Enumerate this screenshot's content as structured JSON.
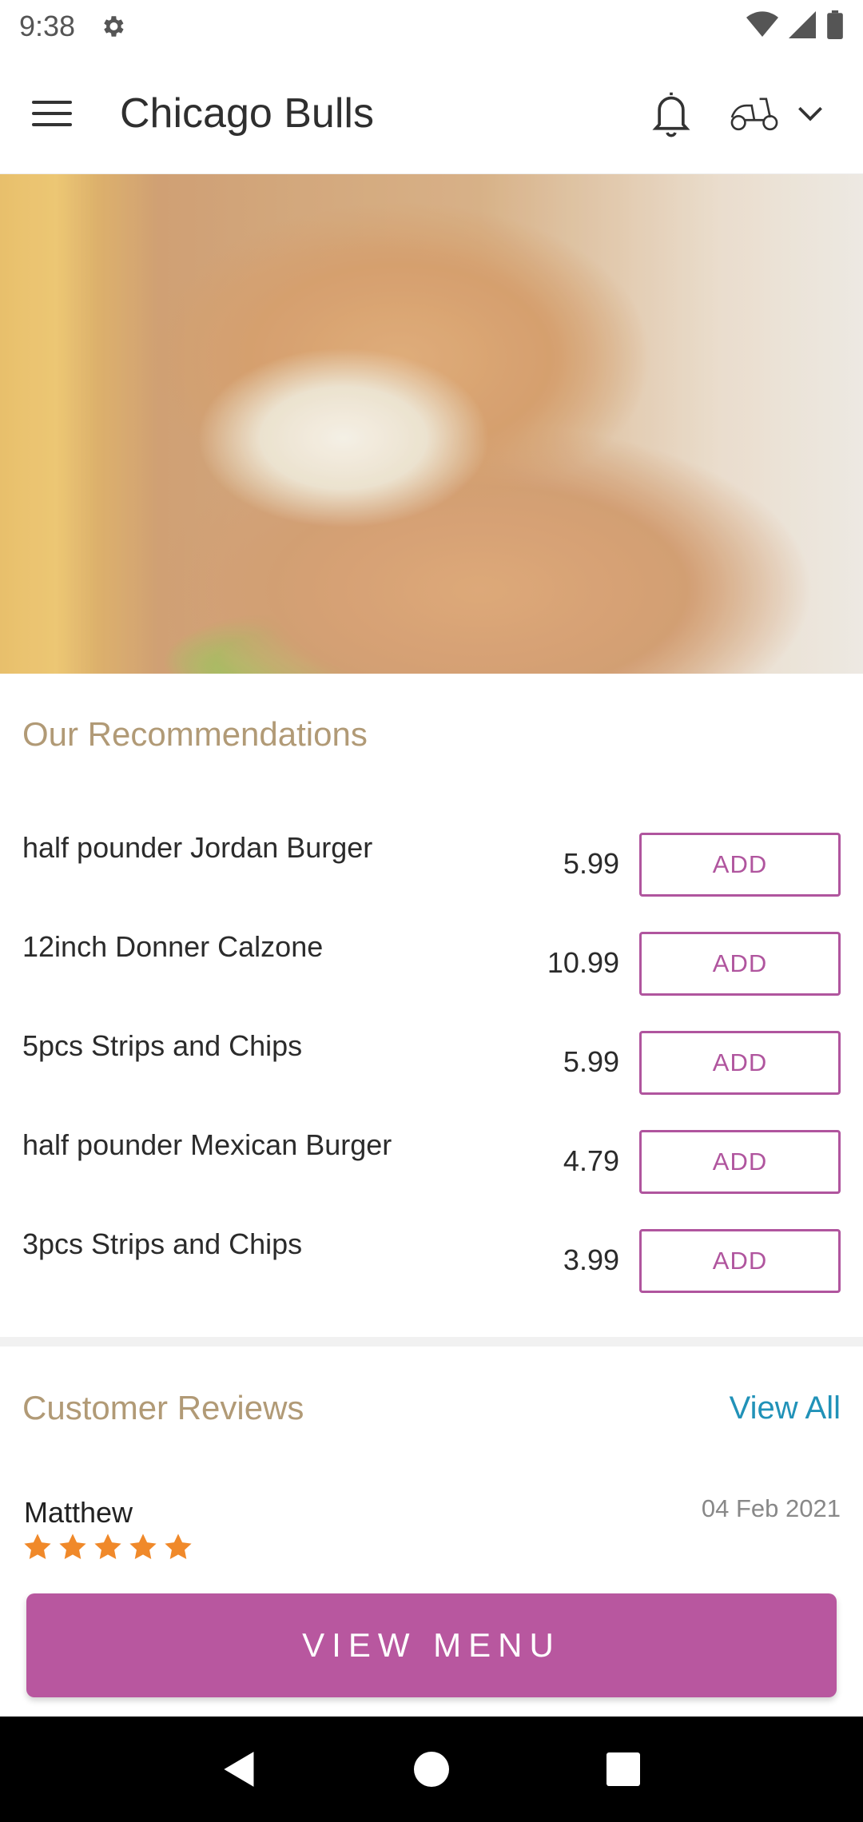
{
  "status_bar": {
    "time": "9:38",
    "icons": [
      "gear-icon",
      "wifi-icon",
      "signal-icon",
      "battery-icon"
    ]
  },
  "app_bar": {
    "title": "Chicago Bulls",
    "icons": [
      "menu-icon",
      "bell-icon",
      "scooter-icon",
      "chevron-down-icon"
    ]
  },
  "hero": {
    "image": "fish-and-chips"
  },
  "recommendations": {
    "title": "Our Recommendations",
    "items": [
      {
        "name": "half pounder Jordan Burger",
        "price": "5.99",
        "button": "ADD"
      },
      {
        "name": "12inch Donner Calzone",
        "price": "10.99",
        "button": "ADD"
      },
      {
        "name": "5pcs Strips and Chips",
        "price": "5.99",
        "button": "ADD"
      },
      {
        "name": "half pounder Mexican Burger",
        "price": "4.79",
        "button": "ADD"
      },
      {
        "name": "3pcs Strips and Chips",
        "price": "3.99",
        "button": "ADD"
      }
    ]
  },
  "reviews": {
    "title": "Customer Reviews",
    "view_all": "View All",
    "items": [
      {
        "name": "Matthew",
        "date": "04 Feb 2021",
        "rating": 5
      }
    ]
  },
  "view_menu_label": "VIEW MENU",
  "nav_bar": {
    "icons": [
      "back-icon",
      "home-icon",
      "recents-icon"
    ]
  },
  "colors": {
    "accent": "#b8579f",
    "section_title": "#b19a76",
    "link": "#2192b8",
    "star": "#f0892a"
  }
}
